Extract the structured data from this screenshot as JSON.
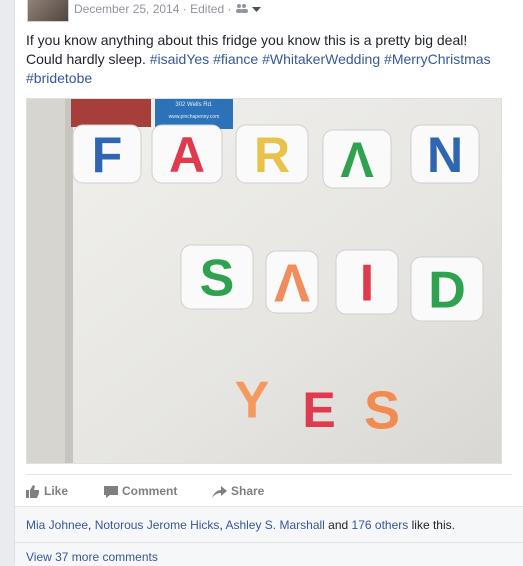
{
  "post": {
    "date": "December 25, 2014",
    "separator": "·",
    "edited": "Edited",
    "text": {
      "line1": "If you know anything about this fridge you know this is a pretty big deal!",
      "line2_prefix": "Could hardly sleep.",
      "hashtags": [
        "#isaidYes",
        "#fiance",
        "#WhitakerWedding",
        "#MerryChristmas",
        "#bridetobe"
      ]
    },
    "photo": {
      "magnet_text_row1": "FARAN",
      "magnet_text_row2": "SAID",
      "magnet_text_row3": "YES",
      "magnet_letters": [
        {
          "ch": "F",
          "color": "#2f66b1"
        },
        {
          "ch": "A",
          "color": "#de3b4e"
        },
        {
          "ch": "R",
          "color": "#e8c24a"
        },
        {
          "ch": "Λ",
          "color": "#2fa24f"
        },
        {
          "ch": "N",
          "color": "#2f66b1"
        },
        {
          "ch": "S",
          "color": "#2fa24f"
        },
        {
          "ch": "Λ",
          "color": "#f18d5c"
        },
        {
          "ch": "I",
          "color": "#de3b4e"
        },
        {
          "ch": "D",
          "color": "#2fa24f"
        },
        {
          "ch": "Y",
          "color": "#f5995f"
        },
        {
          "ch": "E",
          "color": "#de3b4e"
        },
        {
          "ch": "S",
          "color": "#f28b50"
        }
      ],
      "card_text": [
        "302 Wells Rd.",
        "www.pinchapenny.com"
      ]
    }
  },
  "actions": {
    "like": "Like",
    "comment": "Comment",
    "share": "Share"
  },
  "likes": {
    "names": [
      "Mia Johnee",
      "Notorous Jerome Hicks",
      "Ashley S. Marshall"
    ],
    "and_text": "and",
    "others": "176 others",
    "suffix": "like this."
  },
  "comments": {
    "view_more": "View 37 more comments"
  },
  "colors": {
    "link": "#365899",
    "meta": "#90949c",
    "text": "#1d2129"
  }
}
